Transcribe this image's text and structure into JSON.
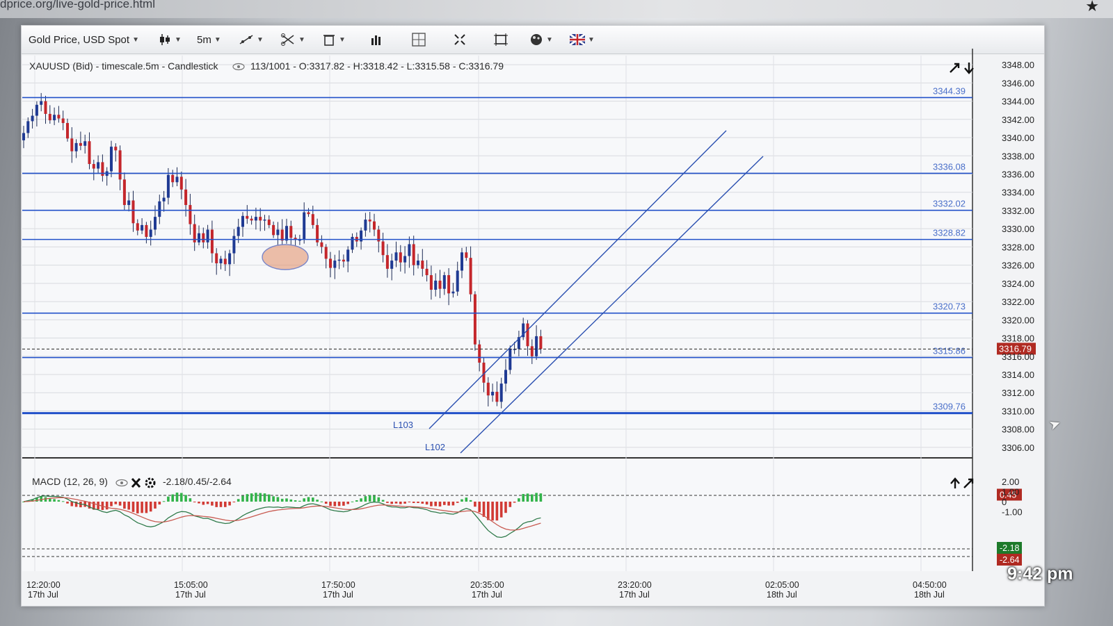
{
  "browser": {
    "url": "dprice.org/live-gold-price.html"
  },
  "toolbar": {
    "symbol_label": "Gold Price, USD Spot",
    "timeframe_label": "5m",
    "items": [
      "candle-type",
      "timeframe",
      "draw-line",
      "crosshair",
      "delete",
      "volume-bars",
      "grid",
      "fullscreen",
      "fit",
      "theme",
      "language"
    ]
  },
  "price_panel": {
    "info_text": "XAUUSD (Bid) - timescale.5m - Candlestick",
    "ohlc_text": "113/1001 - O:3317.82 - H:3318.42 - L:3315.58 - C:3316.79",
    "current_price": "3316.79",
    "y_range": [
      3305,
      3349
    ],
    "y_ticks": [
      "3348.00",
      "3346.00",
      "3344.00",
      "3342.00",
      "3340.00",
      "3338.00",
      "3336.00",
      "3334.00",
      "3332.00",
      "3330.00",
      "3328.00",
      "3326.00",
      "3324.00",
      "3322.00",
      "3320.00",
      "3318.00",
      "3316.00",
      "3314.00",
      "3312.00",
      "3310.00",
      "3308.00",
      "3306.00"
    ],
    "hlines": [
      {
        "value": 3344.39,
        "label": "3344.39"
      },
      {
        "value": 3336.08,
        "label": "3336.08"
      },
      {
        "value": 3332.02,
        "label": "3332.02"
      },
      {
        "value": 3328.82,
        "label": "3328.82"
      },
      {
        "value": 3320.73,
        "label": "3320.73"
      },
      {
        "value": 3315.86,
        "label": "3315.86"
      },
      {
        "value": 3309.76,
        "label": "3309.76"
      }
    ],
    "trend_labels": [
      "L103",
      "L102"
    ]
  },
  "macd_panel": {
    "title": "MACD (12, 26, 9)",
    "values_text": "-2.18/0.45/-2.64",
    "y_ticks": [
      "2.00",
      "1.00",
      "0",
      "-1.00"
    ],
    "badges": [
      {
        "text": "0.45",
        "color": "#b02a22"
      },
      {
        "text": "-2.18",
        "color": "#1e7a2a"
      },
      {
        "text": "-2.64",
        "color": "#b02a22"
      }
    ]
  },
  "x_axis": {
    "ticks": [
      {
        "time": "12:20:00",
        "date": "17th Jul"
      },
      {
        "time": "15:05:00",
        "date": "17th Jul"
      },
      {
        "time": "17:50:00",
        "date": "17th Jul"
      },
      {
        "time": "20:35:00",
        "date": "17th Jul"
      },
      {
        "time": "23:20:00",
        "date": "17th Jul"
      },
      {
        "time": "02:05:00",
        "date": "18th Jul"
      },
      {
        "time": "04:50:00",
        "date": "18th Jul"
      }
    ]
  },
  "overlay": {
    "time": "9:42 pm"
  },
  "colors": {
    "bull": "#1f3a93",
    "bear": "#c4262b",
    "level": "#2150c9",
    "macd_pos": "#32b34a",
    "macd_neg": "#d13a34"
  },
  "chart_data": {
    "type": "candlestick",
    "title": "XAUUSD (Bid) - timescale.5m - Candlestick",
    "ylim": [
      3305,
      3349
    ],
    "candles_close": [
      3340.5,
      3341.8,
      3342.4,
      3343.6,
      3344.0,
      3342.6,
      3341.9,
      3342.5,
      3342.1,
      3341.6,
      3339.9,
      3338.5,
      3339.4,
      3339.1,
      3339.6,
      3337.1,
      3336.6,
      3337.3,
      3335.8,
      3336.3,
      3339.0,
      3338.6,
      3335.4,
      3332.6,
      3333.1,
      3330.6,
      3329.8,
      3330.4,
      3329.1,
      3329.9,
      3331.3,
      3333.0,
      3333.4,
      3335.9,
      3335.1,
      3335.7,
      3334.3,
      3332.6,
      3330.5,
      3328.5,
      3329.5,
      3328.5,
      3329.9,
      3327.3,
      3326.2,
      3326.7,
      3326.1,
      3327.3,
      3329.2,
      3330.2,
      3331.4,
      3331.1,
      3330.9,
      3331.3,
      3330.9,
      3331.0,
      3330.4,
      3329.3,
      3329.9,
      3328.7,
      3330.3,
      3329.0,
      3328.8,
      3328.8,
      3331.8,
      3331.6,
      3330.4,
      3328.5,
      3328.0,
      3326.7,
      3325.7,
      3326.5,
      3326.6,
      3326.4,
      3327.7,
      3329.1,
      3328.6,
      3329.8,
      3331.0,
      3330.8,
      3329.9,
      3328.6,
      3327.1,
      3325.6,
      3326.5,
      3327.4,
      3326.3,
      3327.0,
      3328.3,
      3326.0,
      3326.5,
      3325.6,
      3324.9,
      3323.3,
      3324.3,
      3323.4,
      3324.9,
      3322.9,
      3323.1,
      3325.4,
      3327.4,
      3326.8,
      3322.8,
      3317.3,
      3315.3,
      3313.1,
      3311.7,
      3312.1,
      3311.0,
      3313.0,
      3314.5,
      3316.8,
      3316.8,
      3318.1,
      3319.6,
      3317.1,
      3316.0,
      3318.2,
      3316.8
    ]
  }
}
